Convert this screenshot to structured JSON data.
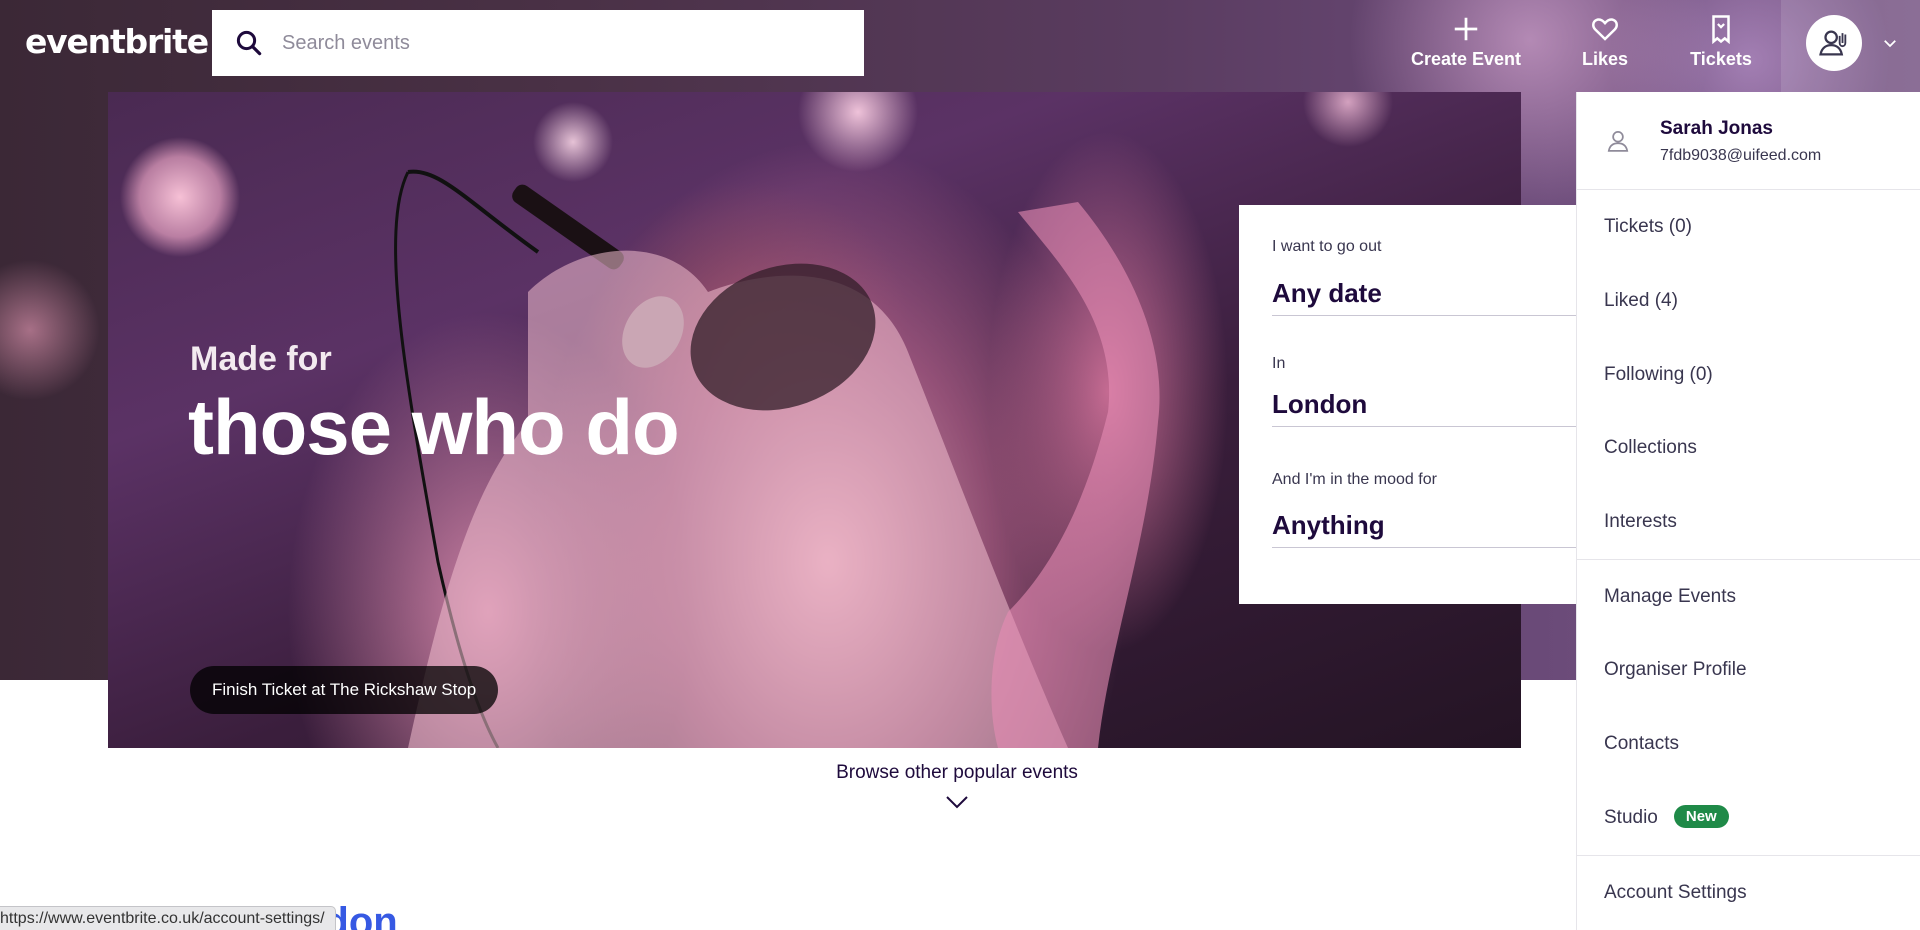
{
  "header": {
    "logo": "eventbrite",
    "search_placeholder": "Search events",
    "nav": {
      "create_event": "Create Event",
      "likes": "Likes",
      "tickets": "Tickets"
    }
  },
  "hero": {
    "subtitle": "Made for",
    "title": "those who do",
    "caption": "Finish Ticket at The Rickshaw Stop"
  },
  "search_form": {
    "date_label": "I want to go out",
    "date_value": "Any date",
    "location_label": "In",
    "location_value": "London",
    "mood_label": "And I'm in the mood for",
    "mood_value": "Anything"
  },
  "browse": {
    "label": "Browse other popular events"
  },
  "section": {
    "partial_heading": "ndon"
  },
  "status_url": "https://www.eventbrite.co.uk/account-settings/",
  "account_menu": {
    "name": "Sarah Jonas",
    "email": "7fdb9038@uifeed.com",
    "items": {
      "tickets": "Tickets (0)",
      "liked": "Liked (4)",
      "following": "Following (0)",
      "collections": "Collections",
      "interests": "Interests",
      "manage_events": "Manage Events",
      "organiser_profile": "Organiser Profile",
      "contacts": "Contacts",
      "studio": "Studio",
      "studio_badge": "New",
      "account_settings": "Account Settings"
    }
  },
  "colors": {
    "brand_text": "#1e0a3c",
    "badge_green": "#1f8a48",
    "link_blue": "#3659e3"
  }
}
